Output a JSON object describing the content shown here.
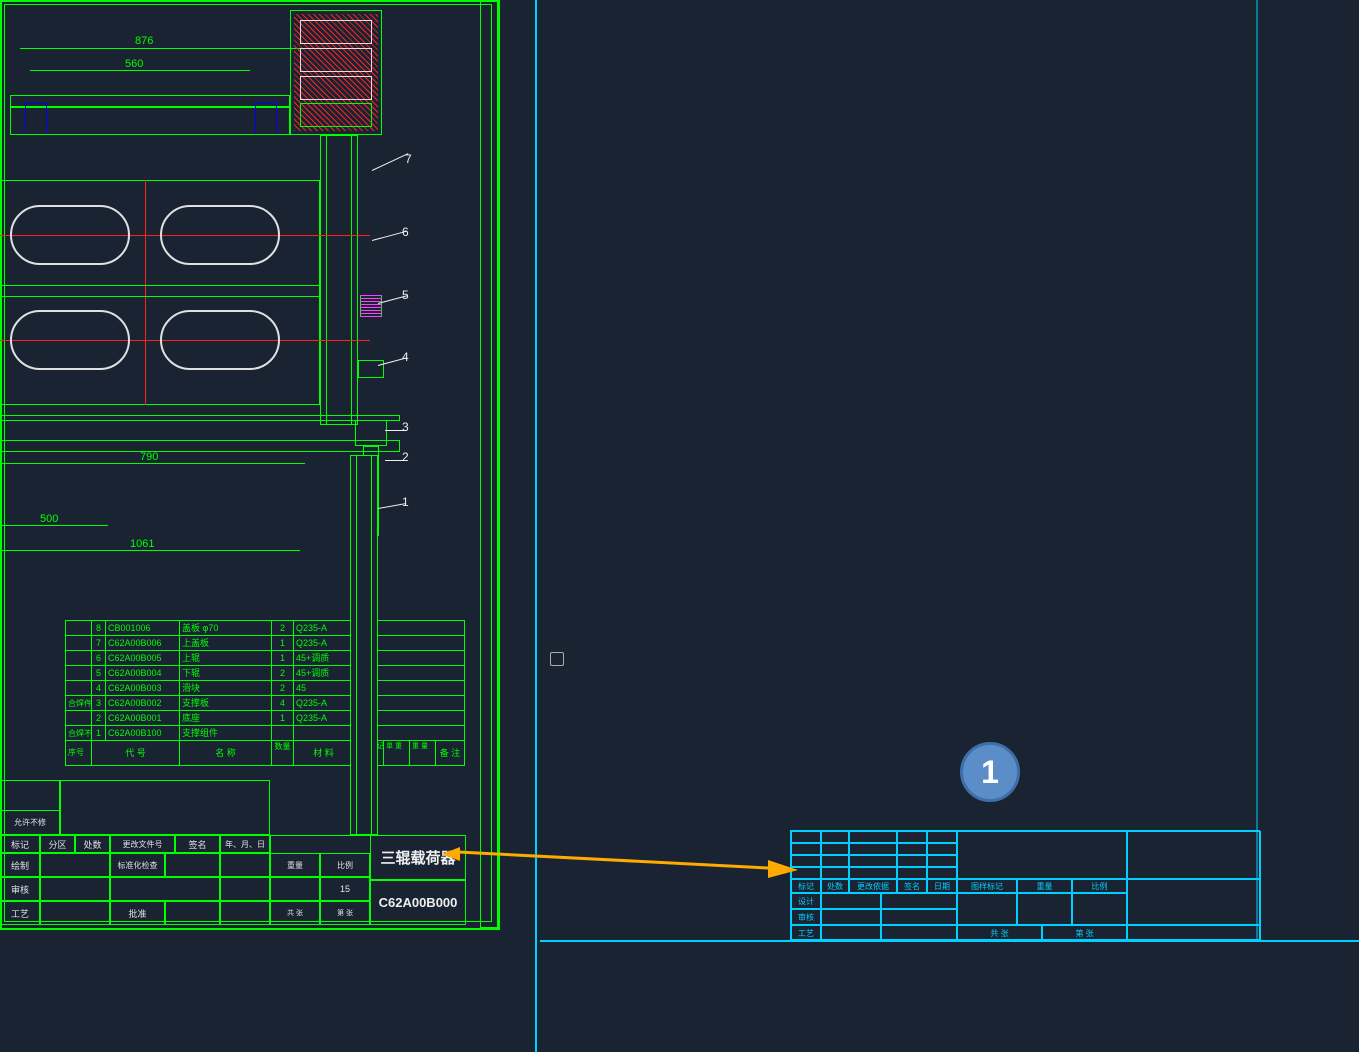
{
  "dimensions": {
    "d1": "876",
    "d2": "560",
    "d3": "790",
    "d4": "500",
    "d5": "1061"
  },
  "callouts": [
    "1",
    "2",
    "3",
    "4",
    "5",
    "6",
    "7"
  ],
  "bom": {
    "rows": [
      {
        "idx": "8",
        "code": "CB001006",
        "name": "盖板 φ70",
        "qty": "2",
        "mat": "Q235-A"
      },
      {
        "idx": "7",
        "code": "C62A00B006",
        "name": "上盖板",
        "qty": "1",
        "mat": "Q235-A"
      },
      {
        "idx": "6",
        "code": "C62A00B005",
        "name": "上辊",
        "qty": "1",
        "mat": "45+调质"
      },
      {
        "idx": "5",
        "code": "C62A00B004",
        "name": "下辊",
        "qty": "2",
        "mat": "45+调质"
      },
      {
        "idx": "4",
        "code": "C62A00B003",
        "name": "滑块",
        "qty": "2",
        "mat": "45"
      },
      {
        "pre": "合焊件",
        "idx": "3",
        "code": "C62A00B002",
        "name": "支撑板",
        "qty": "4",
        "mat": "Q235-A"
      },
      {
        "idx": "2",
        "code": "C62A00B001",
        "name": "底座",
        "qty": "1",
        "mat": "Q235-A"
      },
      {
        "pre": "合焊不焊件",
        "idx": "1",
        "code": "C62A00B100",
        "name": "支撑组件",
        "qty": "",
        "mat": ""
      }
    ],
    "headers": {
      "pre": "序号",
      "h1": "代   号",
      "h2": "名   称",
      "h3": "数量",
      "h4": "材   料",
      "h5": "新件标记",
      "h6": "单  重",
      "h7": "重  量",
      "h8": "备  注"
    }
  },
  "titleblock": {
    "notes": "允许不修",
    "r1": [
      "标记",
      "分区",
      "处数",
      "更改文件号",
      "签名",
      "年、月、日"
    ],
    "r2": [
      "绘制",
      "",
      "",
      "",
      "标准化检查",
      "重量",
      "比例"
    ],
    "r3": [
      "审核",
      "",
      "",
      "",
      "",
      "15",
      ""
    ],
    "r4": [
      "工艺",
      "",
      "批准",
      "",
      "",
      "共  张",
      "第  张"
    ],
    "title": "三辊载荷器",
    "code": "C62A00B000"
  },
  "cyanblock": {
    "cells": [
      "标记",
      "处数",
      "更改依据",
      "签名",
      "日期",
      "图样标记",
      "重量",
      "比例",
      "设计",
      "",
      "",
      "",
      "",
      "",
      "审核",
      "",
      "",
      "",
      "",
      "",
      "工艺",
      "",
      "",
      "",
      "共  张",
      "第  张"
    ]
  },
  "badge": "1"
}
